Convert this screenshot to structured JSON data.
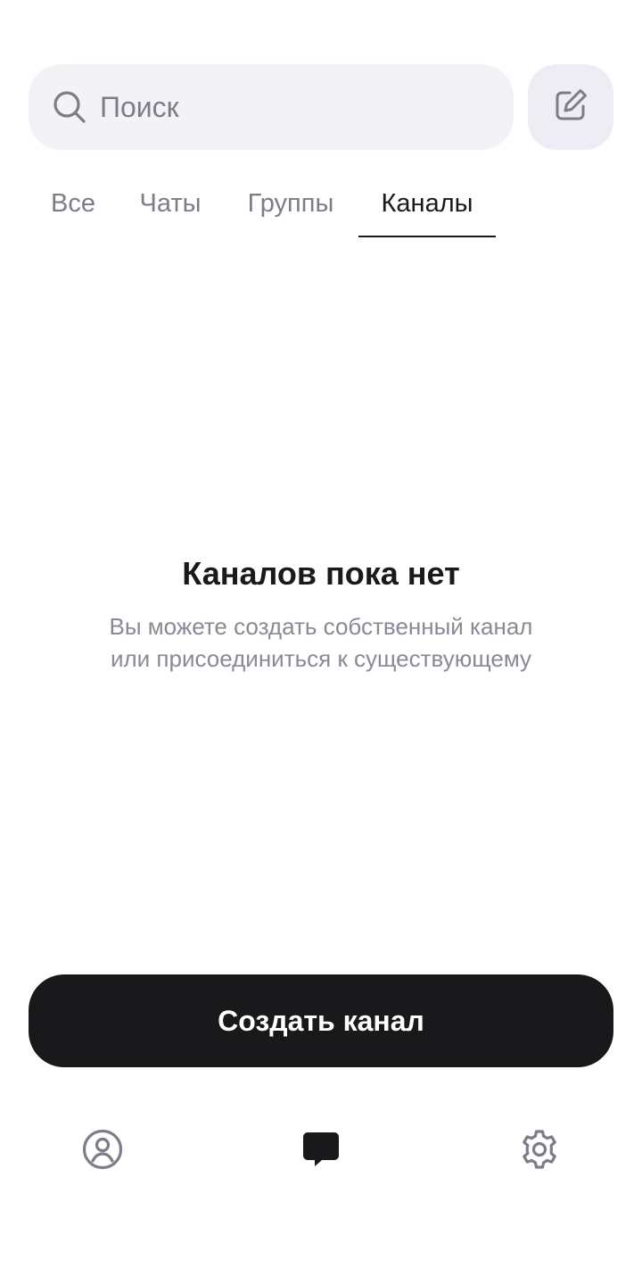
{
  "search": {
    "placeholder": "Поиск",
    "value": ""
  },
  "compose": {
    "icon": "edit-icon"
  },
  "tabs": [
    {
      "label": "Все",
      "active": false
    },
    {
      "label": "Чаты",
      "active": false
    },
    {
      "label": "Группы",
      "active": false
    },
    {
      "label": "Каналы",
      "active": true
    }
  ],
  "empty_state": {
    "title": "Каналов пока нет",
    "description_line1": "Вы можете создать собственный канал",
    "description_line2": "или присоединиться к существующему"
  },
  "create_button": {
    "label": "Создать канал"
  },
  "bottom_nav": [
    {
      "icon": "profile-icon",
      "active": false
    },
    {
      "icon": "chat-icon",
      "active": true
    },
    {
      "icon": "settings-icon",
      "active": false
    }
  ],
  "colors": {
    "primary": "#19191b",
    "muted": "#7d7c88",
    "search_bg": "#f3f3f7"
  }
}
